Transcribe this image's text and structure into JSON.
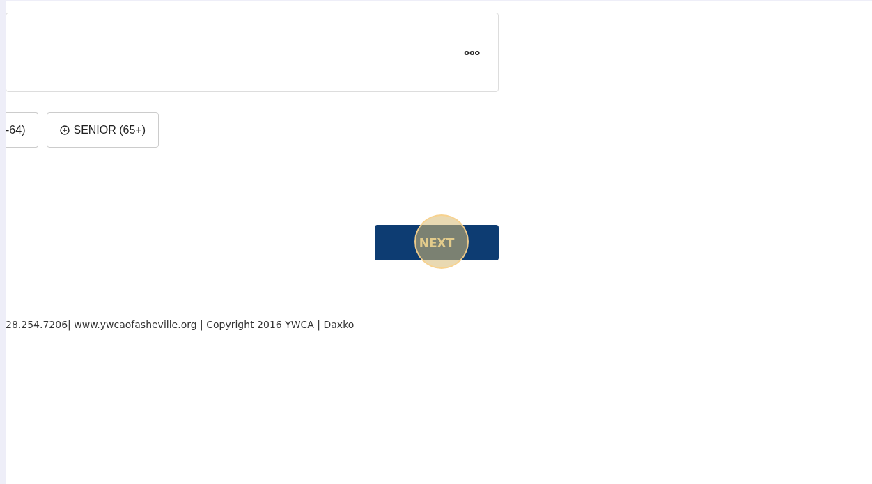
{
  "options_card": {
    "menu": "ooo"
  },
  "age_buttons": [
    {
      "label": "-64)",
      "kind": "cut"
    },
    {
      "label": "SENIOR (65+)",
      "kind": "add"
    }
  ],
  "next_button": {
    "label": "NEXT",
    "clicked": true
  },
  "footer": "28.254.7206| www.ywcaofasheville.org | Copyright 2016 YWCA | Daxko"
}
